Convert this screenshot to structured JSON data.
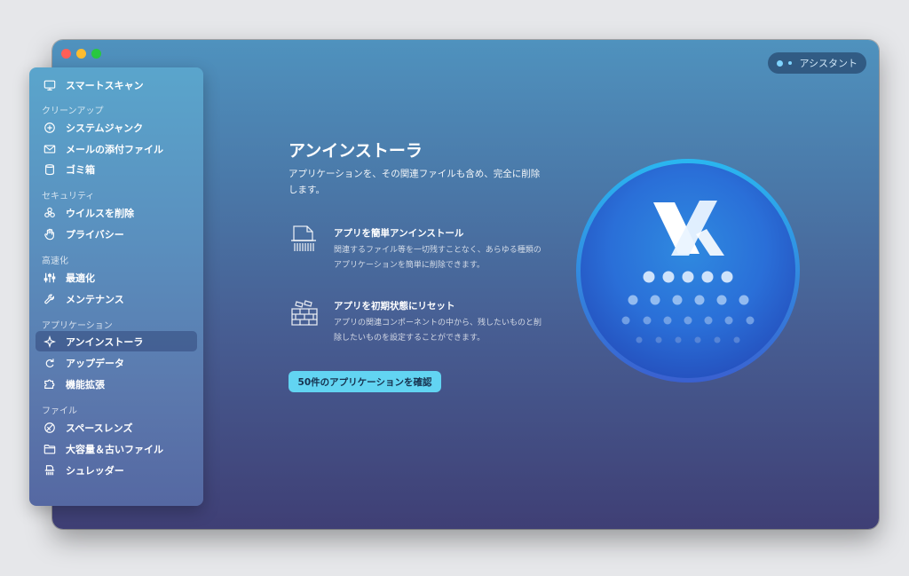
{
  "window": {
    "assistant_label": "アシスタント"
  },
  "sidebar": {
    "items": [
      {
        "label": "スマートスキャン",
        "icon": "monitor-icon"
      },
      {
        "section": "クリーンアップ"
      },
      {
        "label": "システムジャンク",
        "icon": "junk-icon"
      },
      {
        "label": "メールの添付ファイル",
        "icon": "mail-icon"
      },
      {
        "label": "ゴミ箱",
        "icon": "trash-icon"
      },
      {
        "section": "セキュリティ"
      },
      {
        "label": "ウイルスを削除",
        "icon": "biohazard-icon"
      },
      {
        "label": "プライバシー",
        "icon": "hand-icon"
      },
      {
        "section": "高速化"
      },
      {
        "label": "最適化",
        "icon": "sliders-icon"
      },
      {
        "label": "メンテナンス",
        "icon": "wrench-icon"
      },
      {
        "section": "アプリケーション"
      },
      {
        "label": "アンインストーラ",
        "icon": "uninstaller-icon",
        "active": true
      },
      {
        "label": "アップデータ",
        "icon": "updater-icon"
      },
      {
        "label": "機能拡張",
        "icon": "extensions-icon"
      },
      {
        "section": "ファイル"
      },
      {
        "label": "スペースレンズ",
        "icon": "space-lens-icon"
      },
      {
        "label": "大容量＆古いファイル",
        "icon": "folder-icon"
      },
      {
        "label": "シュレッダー",
        "icon": "shredder-icon"
      }
    ]
  },
  "main": {
    "title": "アンインストーラ",
    "description": "アプリケーションを、その関連ファイルも含め、完全に削除します。",
    "features": [
      {
        "title": "アプリを簡単アンインストール",
        "description": "関連するファイル等を一切残すことなく、あらゆる種類のアプリケーションを簡単に削除できます。",
        "icon": "shredding-document-icon"
      },
      {
        "title": "アプリを初期状態にリセット",
        "description": "アプリの関連コンポーネントの中から、残したいものと削除したいものを設定することができます。",
        "icon": "brick-wall-icon"
      }
    ],
    "cta_label": "50件のアプリケーションを確認",
    "hero_icon": "uninstaller-hero-icon"
  },
  "colors": {
    "accent": "#62d4f2",
    "background_top": "#4f92be",
    "background_bottom": "#3f3f75"
  }
}
